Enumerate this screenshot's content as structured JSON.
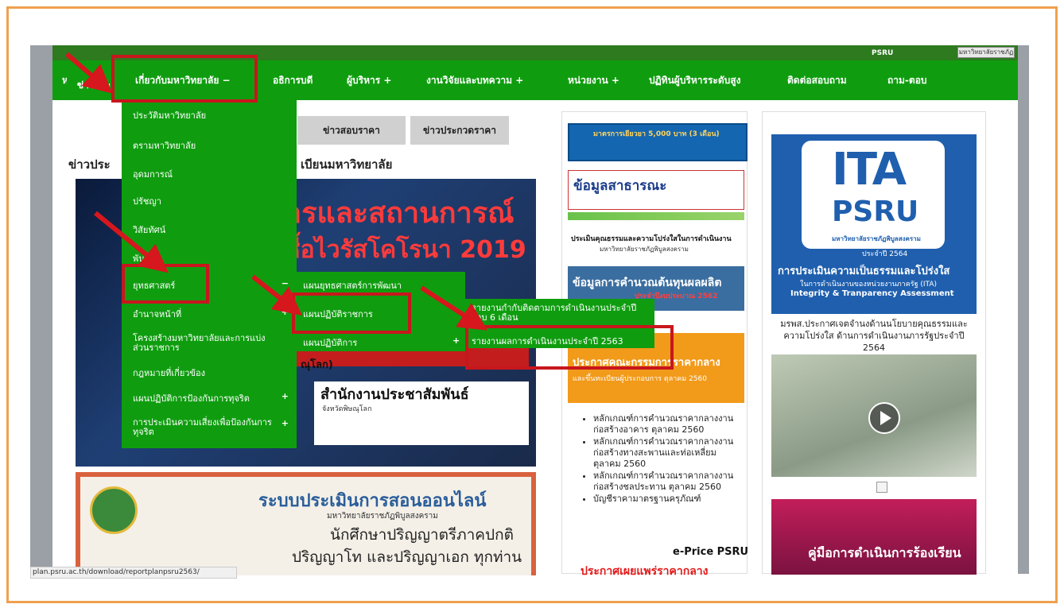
{
  "site": {
    "psru_badge": "PSRU",
    "topbar_logo": "มหาวิทยาลัยราชภัฏ"
  },
  "nav": {
    "home": "หน้าแรก",
    "about": "เกี่ยวกับมหาวิทยาลัย −",
    "president": "อธิการบดี",
    "executives": "ผู้บริหาร +",
    "research": "งานวิจัยและบทความ +",
    "units": "หน่วยงาน +",
    "calendar": "ปฏิทินผู้บริหารระดับสูง",
    "contact": "ติดต่อสอบถาม",
    "faq": "ถาม-ตอบ"
  },
  "dropdown": {
    "items": [
      "ประวัติมหาวิทยาลัย",
      "ตรามหาวิทยาลัย",
      "อุดมการณ์",
      "ปรัชญา",
      "วิสัยทัศน์",
      "พันธกิจ",
      "ยุทธศาสตร์",
      "อำนาจหน้าที่",
      "โครงสร้างมหาวิทยาลัยและการแบ่งส่วนราชการ",
      "กฎหมายที่เกี่ยวข้อง",
      "แผนปฏิบัติการป้องกันการทุจริต",
      "การประเมินความเสี่ยงเพื่อป้องกันการทุจริต"
    ],
    "minus": "−",
    "plus": "+"
  },
  "submenu1": {
    "items": [
      "แผนยุทธศาสตร์การพัฒนา",
      "แผนปฏิบัติราชการ",
      "แผนปฏิบัติการ"
    ]
  },
  "submenu2": {
    "items": [
      "รายงานกำกับติดตามการดำเนินงานประจำปีรอบ 6 เดือน",
      "รายงานผลการดำเนินงานประจำปี 2563"
    ]
  },
  "tabs": {
    "news": "ข่าวประ",
    "bid_news": "ข่าวสอบราคา",
    "price_news": "ข่าวประกวดราคา"
  },
  "news": {
    "heading_left": "ข่าวประ",
    "heading_right": "เบียนมหาวิทยาลัย",
    "banner_title": "สารและสถานการณ์",
    "banner_subtitle": "เชื้อไวรัสโคโรนา 2019",
    "pr_title": "สำนักงานประชาสัมพันธ์",
    "pr_sub": "จังหวัดพิษณุโลก",
    "fragment": "ณุโลก)"
  },
  "banner2": {
    "title": "ระบบประเมินการสอนออนไลน์",
    "sub": "มหาวิทยาลัยราชภัฏพิบูลสงคราม",
    "line1": "นักศึกษาปริญญาตรีภาคปกติ",
    "line2": "ปริญญาโท และปริญญาเอก ทุกท่าน"
  },
  "col3": {
    "banner1": "มาตรการเยียวยา 5,000 บาท (3 เดือน)",
    "banner2": "ข้อมูลสาธารณะ",
    "integrity": "ประเมินคุณธรรมและความโปร่งใสในการดำเนินงาน",
    "integrity_sub": "มหาวิทยาลัยราชภัฏพิบูลสงคราม",
    "banner3": "ข้อมูลการคำนวณต้นทุนผลผลิต",
    "banner3_red": "ประจำปีงบประมาณ 2562",
    "banner4_t1": "ประกาศคณะกรรมการราคากลาง",
    "banner4_t2": "และขึ้นทะเบียนผู้ประกอบการ ตุลาคม 2560",
    "list": [
      "หลักเกณฑ์การคำนวณราคากลางงานก่อสร้างอาคาร ตุลาคม 2560",
      "หลักเกณฑ์การคำนวณราคากลางงานก่อสร้างทางสะพานและท่อเหลี่ยม ตุลาคม 2560",
      "หลักเกณฑ์การคำนวณราคากลางงานก่อสร้างชลประทาน ตุลาคม 2560",
      "บัญชีราคามาตรฐานครุภัณฑ์"
    ],
    "eprice": "e-Price PSRU",
    "eprice_red": "ประกาศเผยแพร่ราคากลาง"
  },
  "col4": {
    "ita": "ITA",
    "psru": "PSRU",
    "uni": "มหาวิทยาลัยราชภัฏพิบูลสงคราม",
    "year": "ประจำปี 2564",
    "h1": "การประเมินความเป็นธรรมและโปร่งใส",
    "h2": "ในการดำเนินงานของหน่วยงานภาครัฐ (ITA)",
    "h3": "Integrity & Tranparency Assessment",
    "caption": "มรพส.ประกาศเจตจำนงด้านนโยบายคุณธรรมและความโปร่งใส ด้านการดำเนินงานภารรัฐประจำปี 2564",
    "bottom": "คู่มือการดำเนินการร้องเรียน"
  },
  "status": {
    "url": "plan.psru.ac.th/download/reportplanpsru2563/"
  },
  "colors": {
    "nav_green": "#0f9d0f",
    "highlight_red": "#c8161d",
    "frame_orange": "#f0a050"
  }
}
